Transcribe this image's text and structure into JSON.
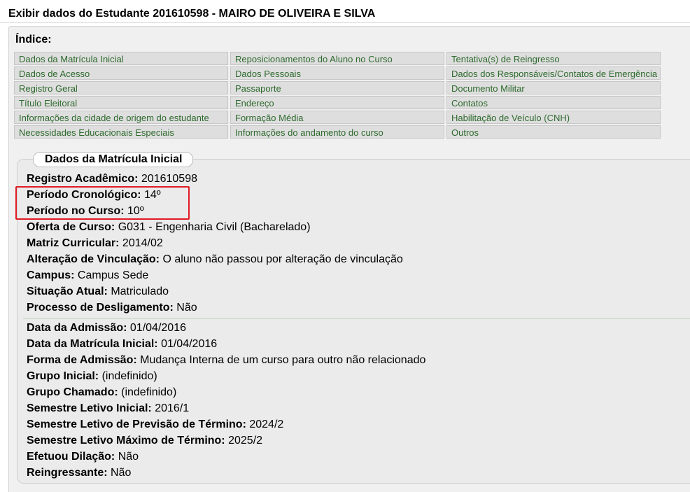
{
  "header": {
    "title": "Exibir dados do Estudante 201610598 - MAIRO DE OLIVEIRA E SILVA"
  },
  "index": {
    "title": "Índice:",
    "links": [
      "Dados da Matrícula Inicial",
      "Reposicionamentos do Aluno no Curso",
      "Tentativa(s) de Reingresso",
      "Dados de Acesso",
      "Dados Pessoais",
      "Dados dos Responsáveis/Contatos de Emergência",
      "Registro Geral",
      "Passaporte",
      "Documento Militar",
      "Título Eleitoral",
      "Endereço",
      "Contatos",
      "Informações da cidade de origem do estudante",
      "Formação Média",
      "Habilitação de Veículo (CNH)",
      "Necessidades Educacionais Especiais",
      "Informações do andamento do curso",
      "Outros"
    ]
  },
  "section": {
    "title": "Dados da Matrícula Inicial",
    "fields": [
      {
        "label": "Registro Acadêmico:",
        "value": "201610598"
      },
      {
        "label": "Período Cronológico:",
        "value": "14º"
      },
      {
        "label": "Período no Curso:",
        "value": "10º"
      },
      {
        "label": "Oferta de Curso:",
        "value": "G031 - Engenharia Civil (Bacharelado)"
      },
      {
        "label": "Matriz Curricular:",
        "value": "2014/02"
      },
      {
        "label": "Alteração de Vinculação:",
        "value": "O aluno não passou por alteração de vinculação"
      },
      {
        "label": "Campus:",
        "value": "Campus Sede"
      },
      {
        "label": "Situação Atual:",
        "value": "Matriculado"
      },
      {
        "label": "Processo de Desligamento:",
        "value": "Não"
      },
      {
        "label": "Data da Admissão:",
        "value": "01/04/2016"
      },
      {
        "label": "Data da Matrícula Inicial:",
        "value": "01/04/2016"
      },
      {
        "label": "Forma de Admissão:",
        "value": "Mudança Interna de um curso para outro não relacionado"
      },
      {
        "label": "Grupo Inicial:",
        "value": "(indefinido)"
      },
      {
        "label": "Grupo Chamado:",
        "value": "(indefinido)"
      },
      {
        "label": "Semestre Letivo Inicial:",
        "value": "2016/1"
      },
      {
        "label": "Semestre Letivo de Previsão de Término:",
        "value": "2024/2"
      },
      {
        "label": "Semestre Letivo Máximo de Término:",
        "value": "2025/2"
      },
      {
        "label": "Efetuou Dilação:",
        "value": "Não"
      },
      {
        "label": "Reingressante:",
        "value": "Não"
      }
    ]
  },
  "colors": {
    "link": "#2e6a2e",
    "highlight": "#e01b24"
  }
}
